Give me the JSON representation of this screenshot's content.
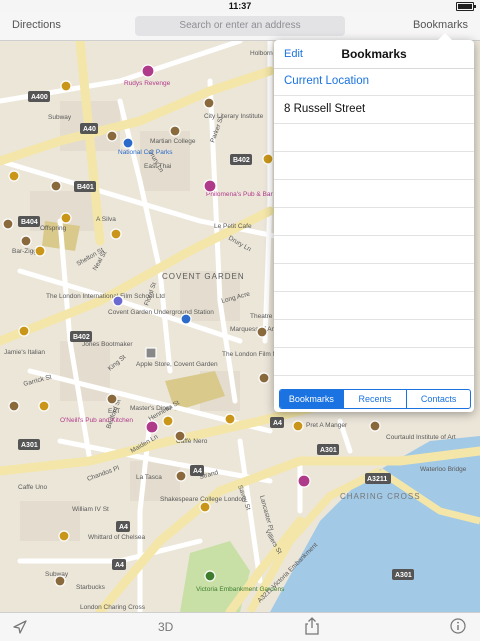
{
  "status": {
    "time": "11:37"
  },
  "nav": {
    "left_label": "Directions",
    "search_placeholder": "Search or enter an address",
    "right_label": "Bookmarks"
  },
  "popover": {
    "edit_label": "Edit",
    "title": "Bookmarks",
    "rows": [
      "Current Location",
      "8 Russell Street",
      "",
      "",
      "",
      "",
      "",
      "",
      "",
      "",
      ""
    ],
    "segments": [
      "Bookmarks",
      "Recents",
      "Contacts"
    ]
  },
  "map": {
    "road_labels": [
      "A400",
      "A40",
      "B402",
      "B401",
      "B404",
      "B402",
      "A4",
      "A4",
      "A4",
      "A4",
      "A301",
      "A301",
      "A3211",
      "A301",
      "Subway",
      "Subway",
      "Offspring",
      "Bar-Ziggy",
      "Drury Ln",
      "Drury Ln",
      "Parker St",
      "Shelton St",
      "Neal St",
      "Floral St",
      "King St",
      "Maiden Ln",
      "Chandos Pl",
      "William IV St",
      "Strand",
      "Bedford St",
      "Savoy St",
      "Lancaster Pl",
      "Villiers St",
      "A3211 Victoria Embankment",
      "Waterloo Bridge",
      "Garrick St",
      "Henrietta St",
      "Long Acre"
    ],
    "place_labels": [
      "Rudys Revenge",
      "City Literary Institute",
      "Martian College",
      "National Car Parks",
      "East Thai",
      "Philomena's Pub & Bar",
      "Le Petit Cafe",
      "A Silva",
      "COVENT GARDEN",
      "The London International Film School Ltd",
      "Covent Garden Underground Station",
      "Jones Bootmaker",
      "Jamie's Italian",
      "Apple Store, Covent Garden",
      "Marquess of Anglesey",
      "The London Film Museum",
      "Theatre",
      "Master's Diner",
      "EAT",
      "O'Neill's Pub and Kitchen",
      "Caffè Nero",
      "La Tasca",
      "Shakespeare College London",
      "Whittard of Chelsea",
      "Caffe Uno",
      "Starbucks",
      "Victoria Embankment Gardens",
      "London Charing Cross",
      "CHARING CROSS",
      "Pret A Manger",
      "Courtauld Institute of Art",
      "Holborn Underground Station"
    ],
    "water_color": "#a2c9e6",
    "park_color": "#c8e0a6"
  },
  "bottom": {
    "threed_label": "3D"
  },
  "colors": {
    "accent": "#1a73e0",
    "map_bg": "#ece6d9"
  }
}
